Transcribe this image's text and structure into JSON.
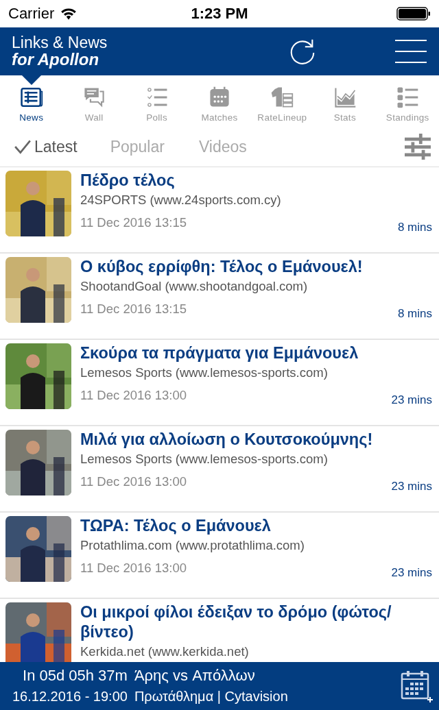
{
  "status_bar": {
    "carrier": "Carrier",
    "time": "1:23 PM"
  },
  "header": {
    "title": "Links & News",
    "subtitle": "for Apollon"
  },
  "nav_tabs": [
    {
      "label": "News",
      "kind": "news",
      "selected": true
    },
    {
      "label": "Wall",
      "kind": "wall",
      "selected": false
    },
    {
      "label": "Polls",
      "kind": "polls",
      "selected": false
    },
    {
      "label": "Matches",
      "kind": "matches",
      "selected": false
    },
    {
      "label": "RateLineup",
      "kind": "lineup",
      "selected": false
    },
    {
      "label": "Stats",
      "kind": "stats",
      "selected": false
    },
    {
      "label": "Standings",
      "kind": "standings",
      "selected": false
    }
  ],
  "filter_tabs": [
    {
      "label": "Latest",
      "selected": true
    },
    {
      "label": "Popular",
      "selected": false
    },
    {
      "label": "Videos",
      "selected": false
    }
  ],
  "articles": [
    {
      "title": "Πέδρο τέλος",
      "source": "24SPORTS (www.24sports.com.cy)",
      "date": "11 Dec 2016 13:15",
      "age": "8 mins"
    },
    {
      "title": "Ο κύβος ερρίφθη: Τέλος ο Εμάνουελ!",
      "source": "ShootandGoal (www.shootandgoal.com)",
      "date": "11 Dec 2016 13:15",
      "age": "8 mins"
    },
    {
      "title": "Σκούρα τα πράγματα για Εμμάνουελ",
      "source": "Lemesos Sports (www.lemesos-sports.com)",
      "date": "11 Dec 2016 13:00",
      "age": "23 mins"
    },
    {
      "title": "Μιλά για αλλοίωση ο Κουτσοκούμνης!",
      "source": "Lemesos Sports (www.lemesos-sports.com)",
      "date": "11 Dec 2016 13:00",
      "age": "23 mins"
    },
    {
      "title": "ΤΩΡΑ: Τέλος ο Εμάνουελ",
      "source": "Protathlima.com (www.protathlima.com)",
      "date": "11 Dec 2016 13:00",
      "age": "23 mins"
    },
    {
      "title": "Οι μικροί φίλοι έδειξαν το δρόμο (φώτος/βίντεο)",
      "source": "Kerkida.net (www.kerkida.net)"
    }
  ],
  "next_match": {
    "countdown": "In 05d 05h 37m",
    "datetime": "16.12.2016 - 19:00",
    "teams": "Άρης vs Απόλλων",
    "competition": "Πρωτάθλημα | Cytavision"
  }
}
